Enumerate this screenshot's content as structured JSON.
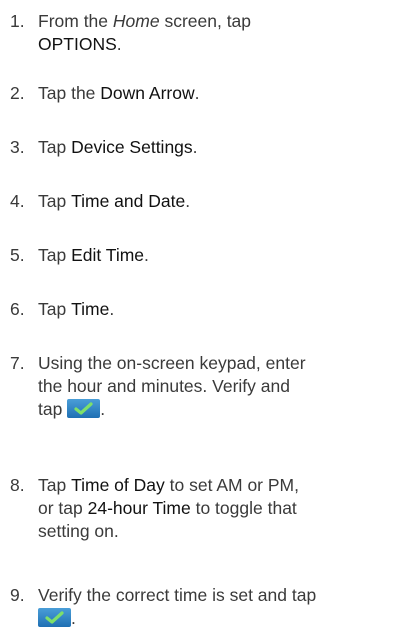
{
  "steps": [
    {
      "num": "1.",
      "line1_pre": "From the ",
      "line1_italic": "Home",
      "line1_post": " screen, tap",
      "line2_bold": "OPTIONS",
      "line2_post": "."
    },
    {
      "num": "2.",
      "pre": "Tap the ",
      "bold": "Down Arrow",
      "post": "."
    },
    {
      "num": "3.",
      "pre": "Tap ",
      "bold": "Device Settings",
      "post": "."
    },
    {
      "num": "4.",
      "pre": "Tap ",
      "bold": "Time and Date",
      "post": "."
    },
    {
      "num": "5.",
      "pre": "Tap ",
      "bold": "Edit Time",
      "post": "."
    },
    {
      "num": "6.",
      "pre": "Tap ",
      "bold": "Time",
      "post": "."
    },
    {
      "num": "7.",
      "line1": "Using the on-screen keypad, enter",
      "line2": "the hour and minutes. Verify and",
      "line3_pre": "tap ",
      "line3_post": "."
    },
    {
      "num": "8.",
      "line1_pre": "Tap ",
      "line1_bold1": "Time of Day",
      "line1_post": " to set AM or PM,",
      "line2_pre": "or tap ",
      "line2_bold": "24-hour Time",
      "line2_post": " to toggle that",
      "line3": "setting on."
    },
    {
      "num": "9.",
      "line1": "Verify the correct time is set and tap",
      "line2_post": "."
    }
  ],
  "icons": {
    "confirm": "checkmark-icon",
    "check_color": "#2a7fc4",
    "check_mark_color": "#7ee06a"
  }
}
